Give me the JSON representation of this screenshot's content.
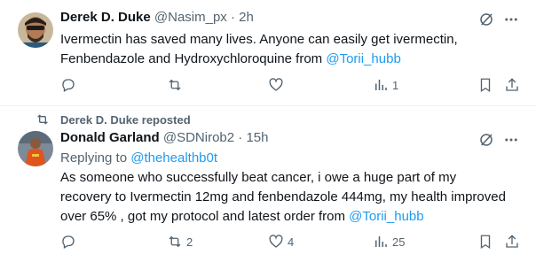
{
  "tweet1": {
    "author_name": "Derek D. Duke",
    "handle": "@Nasim_px",
    "separator": "·",
    "time": "2h",
    "text_line1": "Ivermectin has saved many lives. Anyone can easily get ivermectin,",
    "text_line2_prefix": "Fenbendazole and Hydroxychloroquine from ",
    "mention": "@Torii_hubb",
    "actions": {
      "views": "1"
    }
  },
  "tweet2": {
    "reposted_by": "Derek D. Duke reposted",
    "author_name": "Donald Garland",
    "handle": "@SDNirob2",
    "separator": "·",
    "time": "15h",
    "replying_prefix": "Replying to ",
    "replying_to": "@thehealthb0t",
    "text_line1": "As someone who successfully beat cancer, i owe a huge part of my",
    "text_line2": "recovery to Ivermectin 12mg and fenbendazole 444mg, my health improved",
    "text_line3_prefix": "over 65% , got my protocol and latest order from ",
    "mention": "@Torii_hubb",
    "actions": {
      "reposts": "2",
      "likes": "4",
      "views": "25"
    }
  },
  "icons": {
    "grok": "grok-icon",
    "more": "more-icon",
    "reply": "reply-icon",
    "repost": "repost-icon",
    "like": "heart-icon",
    "views": "views-icon",
    "bookmark": "bookmark-icon",
    "share": "share-icon"
  },
  "colors": {
    "text": "#0f1419",
    "secondary": "#536471",
    "link": "#1d9bf0",
    "divider": "#eff3f4"
  }
}
